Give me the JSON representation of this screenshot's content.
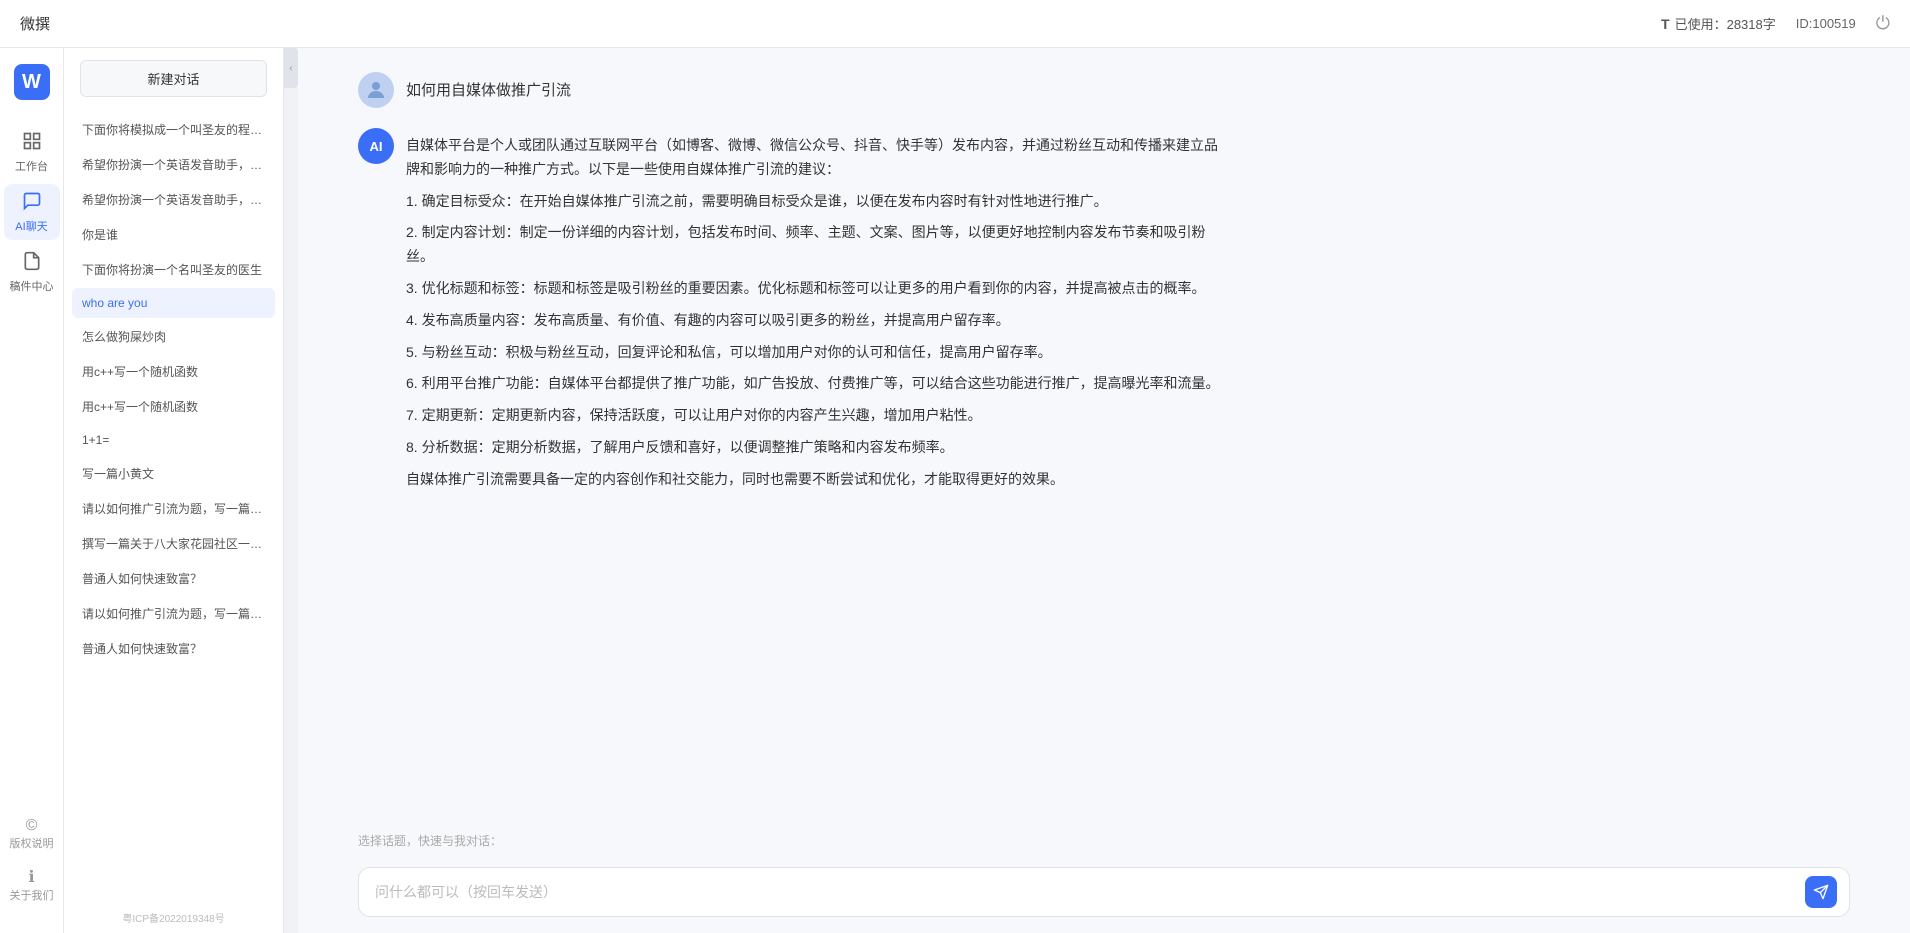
{
  "topbar": {
    "title": "微撰",
    "usage_label": "已使用：28318字",
    "usage_icon": "T",
    "id_label": "ID:100519",
    "logout_icon": "⏻"
  },
  "logo": {
    "icon": "W",
    "text": "微撰"
  },
  "nav_items": [
    {
      "id": "workbench",
      "icon": "⊞",
      "label": "工作台"
    },
    {
      "id": "ai-chat",
      "icon": "💬",
      "label": "AI聊天",
      "active": true
    },
    {
      "id": "draft",
      "icon": "📄",
      "label": "稿件中心"
    }
  ],
  "nav_bottom_items": [
    {
      "id": "copyright",
      "icon": "©",
      "label": "版权说明"
    },
    {
      "id": "about",
      "icon": "ℹ",
      "label": "关于我们"
    }
  ],
  "history": {
    "new_chat_label": "新建对话",
    "items": [
      {
        "id": 1,
        "text": "下面你将模拟成一个叫圣友的程序员、我说...",
        "active": false
      },
      {
        "id": 2,
        "text": "希望你扮演一个英语发音助手，我提供给你...",
        "active": false
      },
      {
        "id": 3,
        "text": "希望你扮演一个英语发音助手，我提供给你...",
        "active": false
      },
      {
        "id": 4,
        "text": "你是谁",
        "active": false
      },
      {
        "id": 5,
        "text": "下面你将扮演一个名叫圣友的医生",
        "active": false
      },
      {
        "id": 6,
        "text": "who are you",
        "active": true
      },
      {
        "id": 7,
        "text": "怎么做狗屎炒肉",
        "active": false
      },
      {
        "id": 8,
        "text": "用c++写一个随机函数",
        "active": false
      },
      {
        "id": 9,
        "text": "用c++写一个随机函数",
        "active": false
      },
      {
        "id": 10,
        "text": "1+1=",
        "active": false
      },
      {
        "id": 11,
        "text": "写一篇小黄文",
        "active": false
      },
      {
        "id": 12,
        "text": "请以如何推广引流为题，写一篇大纲",
        "active": false
      },
      {
        "id": 13,
        "text": "撰写一篇关于八大家花园社区一刻钟便民生...",
        "active": false
      },
      {
        "id": 14,
        "text": "普通人如何快速致富？",
        "active": false
      },
      {
        "id": 15,
        "text": "请以如何推广引流为题，写一篇大纲",
        "active": false
      },
      {
        "id": 16,
        "text": "普通人如何快速致富？",
        "active": false
      }
    ],
    "icp": "粤ICP备2022019348号"
  },
  "chat": {
    "user_question": "如何用自媒体做推广引流",
    "ai_response_paragraphs": [
      "自媒体平台是个人或团队通过互联网平台（如博客、微博、微信公众号、抖音、快手等）发布内容，并通过粉丝互动和传播来建立品牌和影响力的一种推广方式。以下是一些使用自媒体推广引流的建议：",
      "1. 确定目标受众：在开始自媒体推广引流之前，需要明确目标受众是谁，以便在发布内容时有针对性地进行推广。",
      "2. 制定内容计划：制定一份详细的内容计划，包括发布时间、频率、主题、文案、图片等，以便更好地控制内容发布节奏和吸引粉丝。",
      "3. 优化标题和标签：标题和标签是吸引粉丝的重要因素。优化标题和标签可以让更多的用户看到你的内容，并提高被点击的概率。",
      "4. 发布高质量内容：发布高质量、有价值、有趣的内容可以吸引更多的粉丝，并提高用户留存率。",
      "5. 与粉丝互动：积极与粉丝互动，回复评论和私信，可以增加用户对你的认可和信任，提高用户留存率。",
      "6. 利用平台推广功能：自媒体平台都提供了推广功能，如广告投放、付费推广等，可以结合这些功能进行推广，提高曝光率和流量。",
      "7. 定期更新：定期更新内容，保持活跃度，可以让用户对你的内容产生兴趣，增加用户粘性。",
      "8. 分析数据：定期分析数据，了解用户反馈和喜好，以便调整推广策略和内容发布频率。",
      "自媒体推广引流需要具备一定的内容创作和社交能力，同时也需要不断尝试和优化，才能取得更好的效果。"
    ],
    "quick_prompt_label": "选择话题，快速与我对话：",
    "input_placeholder": "问什么都可以（按回车发送）"
  }
}
